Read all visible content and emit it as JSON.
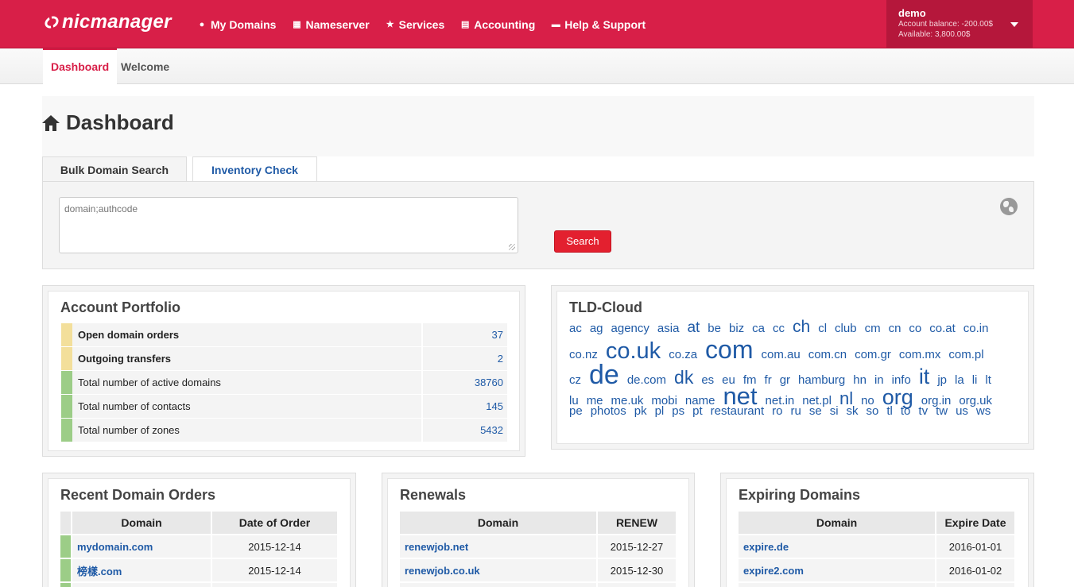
{
  "app": {
    "brand": "nicmanager"
  },
  "nav": {
    "items": [
      {
        "label": "My Domains",
        "icon": "globe-icon"
      },
      {
        "label": "Nameserver",
        "icon": "sitemap-icon"
      },
      {
        "label": "Services",
        "icon": "star-icon"
      },
      {
        "label": "Accounting",
        "icon": "money-icon"
      },
      {
        "label": "Help & Support",
        "icon": "comments-icon"
      }
    ]
  },
  "user": {
    "name": "demo",
    "balance": "Account balance: -200.00$",
    "available": "Available: 3,800.00$"
  },
  "subnav": {
    "active": "Dashboard",
    "other": "Welcome"
  },
  "page": {
    "title": "Dashboard"
  },
  "search": {
    "tab_bulk": "Bulk Domain Search",
    "tab_inventory": "Inventory Check",
    "placeholder": "domain;authcode",
    "button": "Search"
  },
  "portfolio": {
    "title": "Account Portfolio",
    "rows": [
      {
        "label": "Open domain orders",
        "value": "37",
        "bold": true,
        "color": "yellow"
      },
      {
        "label": "Outgoing transfers",
        "value": "2",
        "bold": true,
        "color": "yellow"
      },
      {
        "label": "Total number of active domains",
        "value": "38760",
        "bold": false,
        "color": "green"
      },
      {
        "label": "Total number of contacts",
        "value": "145",
        "bold": false,
        "color": "green"
      },
      {
        "label": "Total number of zones",
        "value": "5432",
        "bold": false,
        "color": "green"
      }
    ]
  },
  "tld_cloud": {
    "title": "TLD-Cloud",
    "lines": [
      [
        [
          "ac",
          15
        ],
        [
          "ag",
          15
        ],
        [
          "agency",
          15
        ],
        [
          "asia",
          15
        ],
        [
          "at",
          19
        ],
        [
          "be",
          15
        ],
        [
          "biz",
          15
        ],
        [
          "ca",
          15
        ],
        [
          "cc",
          15
        ],
        [
          "ch",
          21
        ],
        [
          "cl",
          15
        ],
        [
          "club",
          15
        ],
        [
          "cm",
          15
        ],
        [
          "cn",
          15
        ],
        [
          "co",
          15
        ],
        [
          "co.at",
          15
        ],
        [
          "co.in",
          15
        ]
      ],
      [
        [
          "co.nz",
          15
        ],
        [
          "co.uk",
          29
        ],
        [
          "co.za",
          15
        ],
        [
          "com",
          32
        ],
        [
          "com.au",
          15
        ],
        [
          "com.cn",
          15
        ],
        [
          "com.gr",
          15
        ],
        [
          "com.mx",
          15
        ],
        [
          "com.pl",
          15
        ]
      ],
      [
        [
          "cz",
          15
        ],
        [
          "de",
          34
        ],
        [
          "de.com",
          15
        ],
        [
          "dk",
          23
        ],
        [
          "es",
          15
        ],
        [
          "eu",
          15
        ],
        [
          "fm",
          15
        ],
        [
          "fr",
          15
        ],
        [
          "gr",
          15
        ],
        [
          "hamburg",
          15
        ],
        [
          "hn",
          15
        ],
        [
          "in",
          15
        ],
        [
          "info",
          15
        ],
        [
          "it",
          27
        ],
        [
          "jp",
          15
        ],
        [
          "la",
          15
        ],
        [
          "li",
          15
        ],
        [
          "lt",
          15
        ]
      ],
      [
        [
          "lu",
          15
        ],
        [
          "me",
          15
        ],
        [
          "me.uk",
          15
        ],
        [
          "mobi",
          15
        ],
        [
          "name",
          15
        ],
        [
          "net",
          31
        ],
        [
          "net.in",
          15
        ],
        [
          "net.pl",
          15
        ],
        [
          "nl",
          22
        ],
        [
          "no",
          15
        ],
        [
          "org",
          27
        ],
        [
          "org.in",
          15
        ],
        [
          "org.uk",
          15
        ]
      ],
      [
        [
          "pe",
          15
        ],
        [
          "photos",
          15
        ],
        [
          "pk",
          15
        ],
        [
          "pl",
          15
        ],
        [
          "ps",
          15
        ],
        [
          "pt",
          15
        ],
        [
          "restaurant",
          15
        ],
        [
          "ro",
          15
        ],
        [
          "ru",
          15
        ],
        [
          "se",
          15
        ],
        [
          "si",
          15
        ],
        [
          "sk",
          15
        ],
        [
          "so",
          15
        ],
        [
          "tl",
          15
        ],
        [
          "to",
          15
        ],
        [
          "tv",
          15
        ],
        [
          "tw",
          15
        ],
        [
          "us",
          15
        ],
        [
          "ws",
          15
        ]
      ]
    ]
  },
  "recent_orders": {
    "title": "Recent Domain Orders",
    "col_domain": "Domain",
    "col_date": "Date of Order",
    "rows": [
      {
        "domain": "mydomain.com",
        "date": "2015-12-14"
      },
      {
        "domain": "榜樣.com",
        "date": "2015-12-14"
      }
    ]
  },
  "renewals": {
    "title": "Renewals",
    "col_domain": "Domain",
    "col_date": "RENEW",
    "rows": [
      {
        "domain": "renewjob.net",
        "date": "2015-12-27"
      },
      {
        "domain": "renewjob.co.uk",
        "date": "2015-12-30"
      }
    ]
  },
  "expiring": {
    "title": "Expiring Domains",
    "col_domain": "Domain",
    "col_date": "Expire Date",
    "rows": [
      {
        "domain": "expire.de",
        "date": "2016-01-01"
      },
      {
        "domain": "expire2.com",
        "date": "2016-01-02"
      }
    ]
  },
  "colors": {
    "brand": "#d81f48",
    "link": "#1f5aa6",
    "search_button": "#e3202f",
    "bar_yellow": "#f3df9b",
    "bar_green": "#9ccd87"
  }
}
